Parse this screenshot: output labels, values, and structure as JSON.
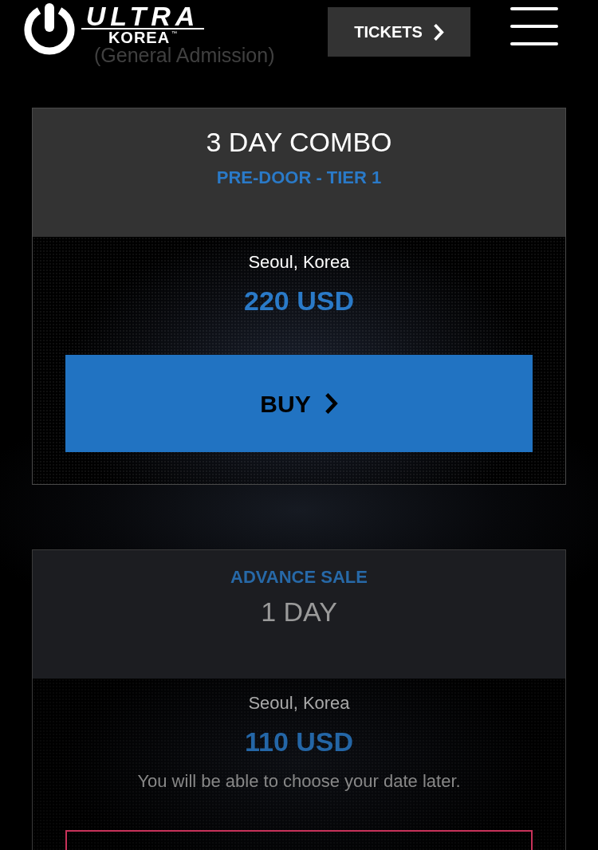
{
  "header": {
    "logo": {
      "wordmark": "ULTRA",
      "subtitle": "KOREA",
      "trademark": "™"
    },
    "tickets_button": {
      "label": "TICKETS"
    }
  },
  "page_heading": {
    "label": "(General Admission)"
  },
  "tickets": [
    {
      "disabled": false,
      "heading": [
        {
          "kind": "title",
          "text": "3 DAY COMBO"
        },
        {
          "kind": "tier",
          "text": "PRE-DOOR - TIER 1"
        }
      ],
      "location": "Seoul, Korea",
      "price": "220 USD",
      "button": {
        "label": "BUY"
      }
    },
    {
      "disabled": true,
      "heading": [
        {
          "kind": "tier",
          "text": "ADVANCE SALE"
        },
        {
          "kind": "title",
          "text": "1 DAY"
        }
      ],
      "location": "Seoul, Korea",
      "price": "110 USD",
      "note": "You will be able to choose your date later."
    }
  ]
}
